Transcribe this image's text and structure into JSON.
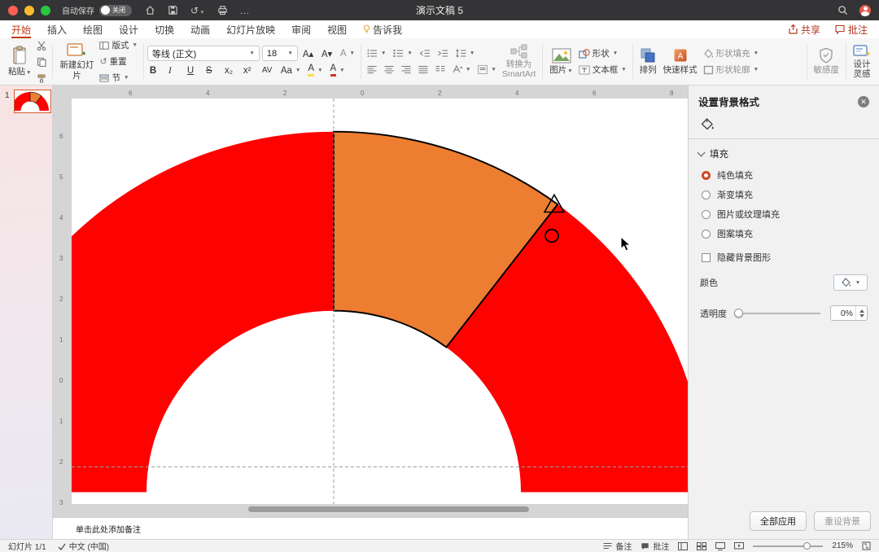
{
  "colors": {
    "shape_red": "#fe0202",
    "shape_orange": "#ed7d31",
    "accent": "#c13a17"
  },
  "titlebar": {
    "autosave_label": "自动保存",
    "autosave_state": "关闭",
    "title": "演示文稿 5"
  },
  "tabbar": {
    "tabs": [
      "开始",
      "插入",
      "绘图",
      "设计",
      "切换",
      "动画",
      "幻灯片放映",
      "审阅",
      "视图",
      "告诉我"
    ],
    "active_tab": "开始",
    "share": "共享",
    "comments": "批注"
  },
  "ribbon": {
    "paste": "粘贴",
    "new_slide": "新建幻灯片",
    "layout": "版式",
    "reset": "重置",
    "section": "节",
    "font_name": "等线 (正文)",
    "font_size": "18",
    "bold": "B",
    "italic": "I",
    "underline": "U",
    "strike": "S",
    "subscript": "x₂",
    "superscript": "x²",
    "spacing": "AV",
    "case": "Aa",
    "font_color": "A",
    "highlight": "A",
    "inc_font": "A▴",
    "dec_font": "A▾",
    "clear_format": "A",
    "smartart_line1": "转换为",
    "smartart_line2": "SmartArt",
    "picture": "图片",
    "shapes": "形状",
    "textbox": "文本框",
    "arrange": "排列",
    "quick_styles": "快速样式",
    "shape_fill": "形状填充",
    "shape_outline": "形状轮廓",
    "sensitivity": "敏感度",
    "design_ideas_line1": "设计",
    "design_ideas_line2": "灵感"
  },
  "slides_panel": {
    "slide_number": "1"
  },
  "canvas": {
    "notes_placeholder": "单击此处添加备注",
    "hruler": [
      "6",
      "4",
      "2",
      "0",
      "2",
      "4",
      "6",
      "8"
    ],
    "vruler": [
      "6",
      "5",
      "4",
      "3",
      "2",
      "1",
      "0",
      "1",
      "2",
      "3"
    ]
  },
  "format_panel": {
    "title": "设置背景格式",
    "close": "✕",
    "section_fill": "填充",
    "fill_options": [
      {
        "label": "纯色填充",
        "selected": true
      },
      {
        "label": "渐变填充",
        "selected": false
      },
      {
        "label": "图片或纹理填充",
        "selected": false
      },
      {
        "label": "图案填充",
        "selected": false
      }
    ],
    "hide_background": "隐藏背景图形",
    "color_label": "颜色",
    "transparency_label": "透明度",
    "transparency_value": "0%",
    "apply_all": "全部应用",
    "reset_background": "重设背景"
  },
  "statusbar": {
    "slide_info": "幻灯片 1/1",
    "language": "中文 (中国)",
    "notes": "备注",
    "comments": "批注",
    "zoom": "215%"
  }
}
